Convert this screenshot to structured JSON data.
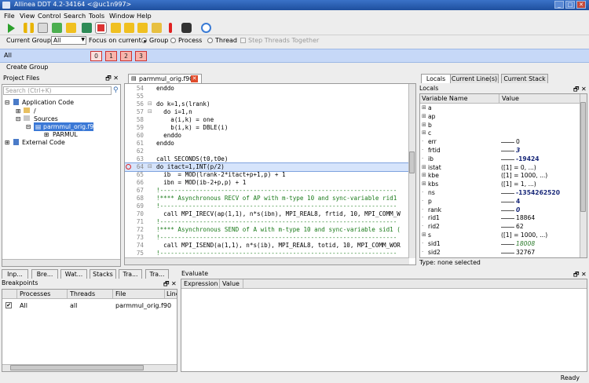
{
  "window": {
    "title": "Allinea DDT 4.2-34164 <@uc1n997>",
    "min": "_",
    "max": "□",
    "close": "✕"
  },
  "menu": [
    "File",
    "View",
    "Control",
    "Search",
    "Tools",
    "Window",
    "Help"
  ],
  "groupbar": {
    "current_group_label": "Current Group:",
    "current_group_value": "All",
    "focus_label": "Focus on current:",
    "group": "Group",
    "process": "Process",
    "thread": "Thread",
    "step_together": "Step Threads Together"
  },
  "procbar": {
    "label": "All",
    "processes": [
      "0",
      "1",
      "2",
      "3"
    ]
  },
  "create_group": "Create Group",
  "project_files": {
    "title": "Project Files",
    "search_placeholder": "Search (Ctrl+K)",
    "items": [
      "Application Code",
      "/",
      "Sources",
      "parmmul_orig.f90",
      "PARMUL",
      "External Code"
    ]
  },
  "editor": {
    "tab": "parmmul_orig.f90",
    "lines": [
      {
        "n": "54",
        "t": "enddo",
        "c": ""
      },
      {
        "n": "55",
        "t": "",
        "c": ""
      },
      {
        "n": "56",
        "t": "do k=1,s(lrank)",
        "c": ""
      },
      {
        "n": "57",
        "t": "  do i=1,n",
        "c": ""
      },
      {
        "n": "58",
        "t": "    a(i,k) = one",
        "c": ""
      },
      {
        "n": "59",
        "t": "    b(i,k) = DBLE(i)",
        "c": ""
      },
      {
        "n": "60",
        "t": "  enddo",
        "c": ""
      },
      {
        "n": "61",
        "t": "enddo",
        "c": ""
      },
      {
        "n": "62",
        "t": "",
        "c": ""
      },
      {
        "n": "63",
        "t": "call SECONDS(t0,t0e)",
        "c": ""
      },
      {
        "n": "64",
        "t": "do itact=1,INT(p/2)",
        "c": "hl"
      },
      {
        "n": "65",
        "t": "  ib  = MOD(lrank-2*itact+p+1,p) + 1",
        "c": ""
      },
      {
        "n": "66",
        "t": "  ibn = MOD(ib-2+p,p) + 1",
        "c": ""
      },
      {
        "n": "67",
        "t": "!------------------------------------------------------------------",
        "c": "cm"
      },
      {
        "n": "68",
        "t": "!**** Asynchronous RECV of AP with m-type 10 and sync-variable rid1",
        "c": "cm"
      },
      {
        "n": "69",
        "t": "!------------------------------------------------------------------",
        "c": "cm"
      },
      {
        "n": "70",
        "t": "  call MPI_IRECV(ap(1,1), n*s(ibn), MPI_REAL8, frtid, 10, MPI_COMM_W",
        "c": ""
      },
      {
        "n": "71",
        "t": "!------------------------------------------------------------------",
        "c": "cm"
      },
      {
        "n": "72",
        "t": "!**** Asynchronous SEND of A with m-type 10 and sync-variable sid1 (",
        "c": "cm"
      },
      {
        "n": "73",
        "t": "!------------------------------------------------------------------",
        "c": "cm"
      },
      {
        "n": "74",
        "t": "  call MPI_ISEND(a(1,1), n*s(ib), MPI_REAL8, totid, 10, MPI_COMM_WOR",
        "c": ""
      },
      {
        "n": "75",
        "t": "!------------------------------------------------------------------",
        "c": "cm"
      }
    ]
  },
  "locals": {
    "tabs": [
      "Locals",
      "Current Line(s)",
      "Current Stack"
    ],
    "title": "Locals",
    "col_name": "Variable Name",
    "col_value": "Value",
    "rows": [
      {
        "n": "a",
        "v": ""
      },
      {
        "n": "ap",
        "v": ""
      },
      {
        "n": "b",
        "v": ""
      },
      {
        "n": "c",
        "v": ""
      },
      {
        "n": "err",
        "v": "0"
      },
      {
        "n": "frtid",
        "v": "3"
      },
      {
        "n": "ib",
        "v": "-19424"
      },
      {
        "n": "istat",
        "v": "([1] = 0, ...)"
      },
      {
        "n": "kbe",
        "v": "([1] = 1000, ...)"
      },
      {
        "n": "kbs",
        "v": "([1] = 1, ...)"
      },
      {
        "n": "ns",
        "v": "-1354262520"
      },
      {
        "n": "p",
        "v": "4"
      },
      {
        "n": "rank",
        "v": "0"
      },
      {
        "n": "rid1",
        "v": "18864"
      },
      {
        "n": "rid2",
        "v": "62"
      },
      {
        "n": "s",
        "v": "([1] = 1000, ...)"
      },
      {
        "n": "sid1",
        "v": "18008"
      },
      {
        "n": "sid2",
        "v": "32767"
      }
    ],
    "status": "Type: none selected"
  },
  "bottom_tabs": [
    "Inp...",
    "Bre...",
    "Wat...",
    "Stacks",
    "Tra...",
    "Tra..."
  ],
  "breakpoints": {
    "title": "Breakpoints",
    "cols": [
      "Processes",
      "Threads",
      "File",
      "Line"
    ],
    "rows": [
      {
        "p": "All",
        "t": "all",
        "f": "parmmul_orig.f90"
      }
    ]
  },
  "evaluate": {
    "title": "Evaluate",
    "cols": [
      "Expression",
      "Value"
    ]
  },
  "status": "Ready"
}
